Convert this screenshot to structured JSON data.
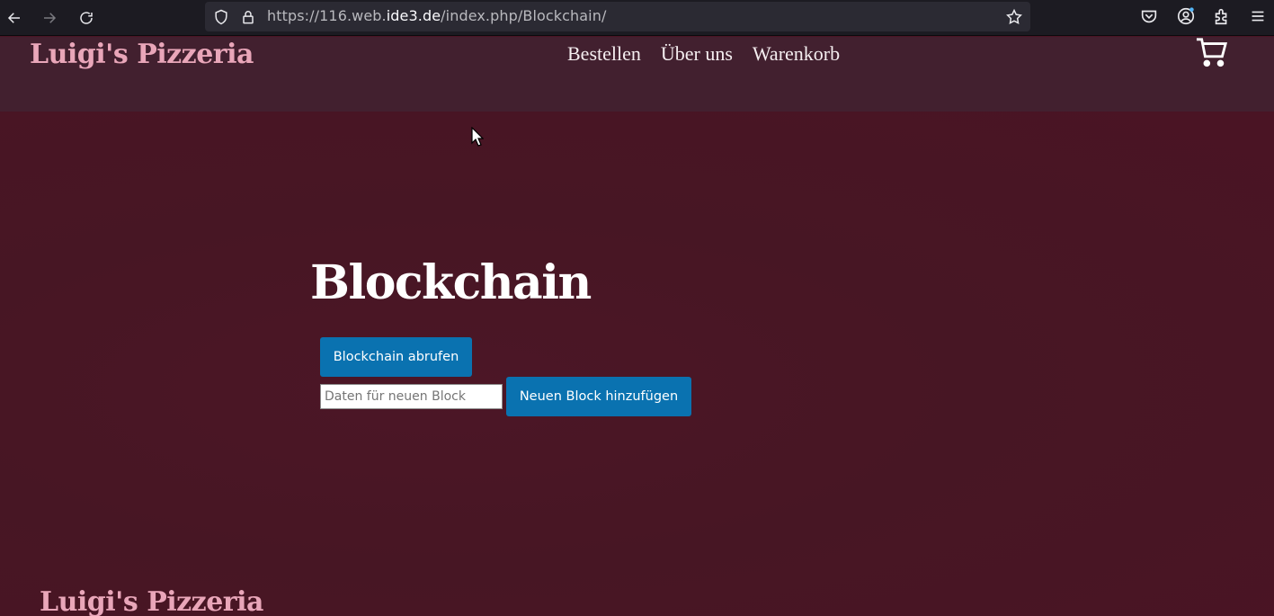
{
  "browser": {
    "url_prefix": "https://116.web.",
    "url_host": "ide3.de",
    "url_path": "/index.php/Blockchain/"
  },
  "header": {
    "brand": "Luigi's Pizzeria",
    "nav": [
      "Bestellen",
      "Über uns",
      "Warenkorb"
    ]
  },
  "main": {
    "title": "Blockchain",
    "fetch_button": "Blockchain abrufen",
    "input_placeholder": "Daten für neuen Block",
    "add_button": "Neuen Block hinzufügen"
  },
  "footer": {
    "brand": "Luigi's Pizzeria"
  },
  "colors": {
    "background": "#4a1424",
    "header": "#42202f",
    "brand": "#e9a6b9",
    "button": "#0a72b0"
  },
  "icons": [
    "back-icon",
    "forward-icon",
    "reload-icon",
    "shield-icon",
    "lock-icon",
    "star-icon",
    "pocket-icon",
    "account-icon",
    "extensions-icon",
    "menu-icon",
    "cart-icon"
  ]
}
